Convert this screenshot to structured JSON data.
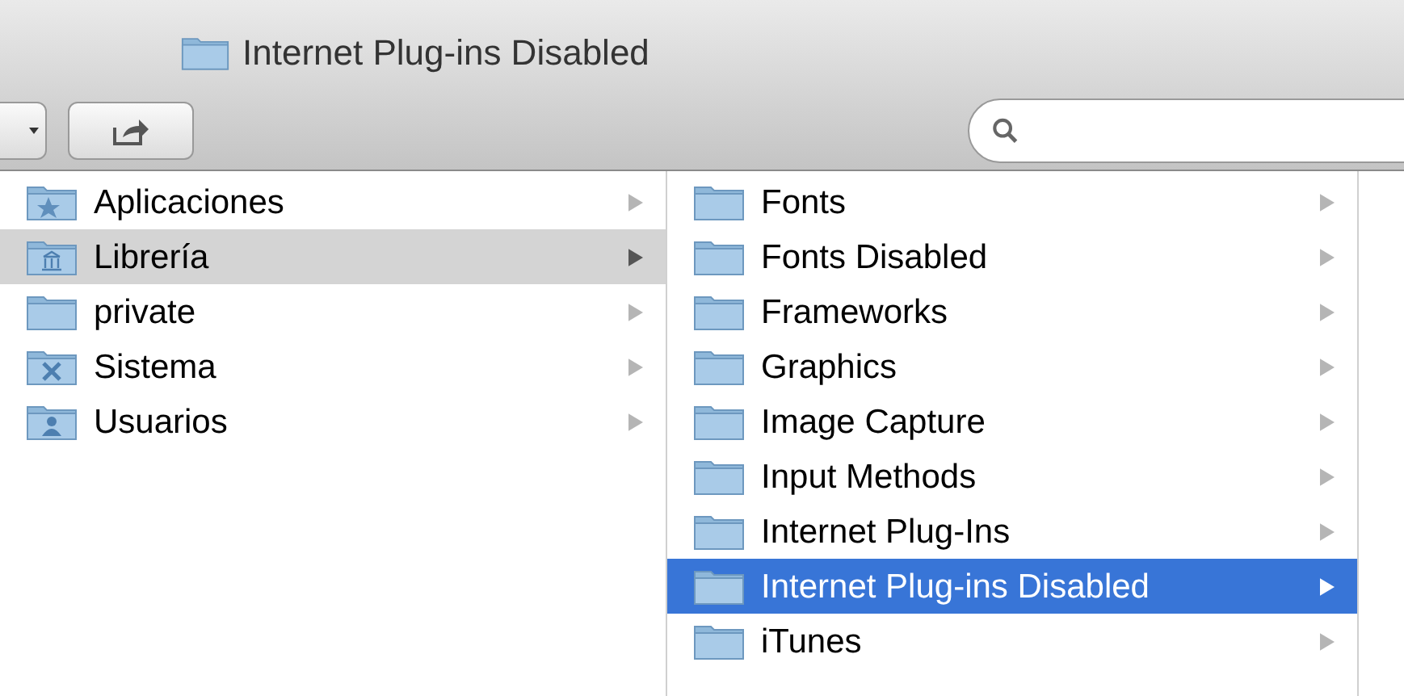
{
  "window": {
    "title": "Internet Plug-ins Disabled"
  },
  "columns": [
    {
      "items": [
        {
          "label": "Aplicaciones",
          "kind": "applications",
          "selected": false
        },
        {
          "label": "Librería",
          "kind": "library",
          "selected": true
        },
        {
          "label": "private",
          "kind": "plain",
          "selected": false
        },
        {
          "label": "Sistema",
          "kind": "system",
          "selected": false
        },
        {
          "label": "Usuarios",
          "kind": "users",
          "selected": false
        }
      ]
    },
    {
      "items": [
        {
          "label": "Fonts",
          "kind": "plain",
          "selected": false
        },
        {
          "label": "Fonts Disabled",
          "kind": "plain",
          "selected": false
        },
        {
          "label": "Frameworks",
          "kind": "plain",
          "selected": false
        },
        {
          "label": "Graphics",
          "kind": "plain",
          "selected": false
        },
        {
          "label": "Image Capture",
          "kind": "plain",
          "selected": false
        },
        {
          "label": "Input Methods",
          "kind": "plain",
          "selected": false
        },
        {
          "label": "Internet Plug-Ins",
          "kind": "plain",
          "selected": false
        },
        {
          "label": "Internet Plug-ins Disabled",
          "kind": "plain",
          "selected": true
        },
        {
          "label": "iTunes",
          "kind": "plain",
          "selected": false
        }
      ]
    }
  ]
}
